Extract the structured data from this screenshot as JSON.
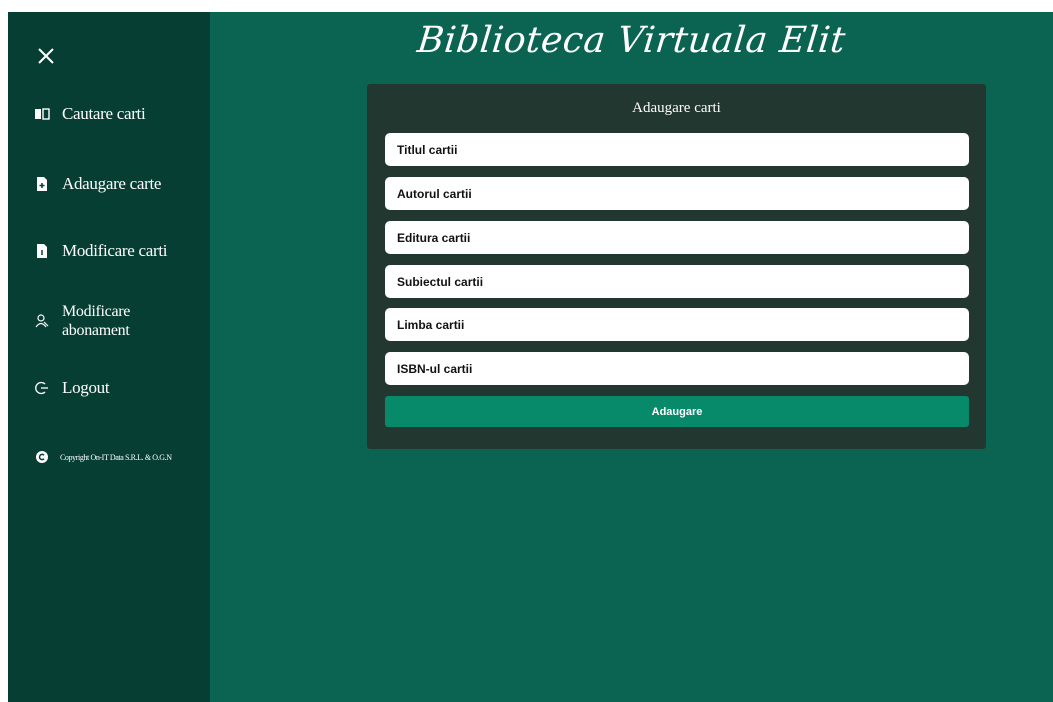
{
  "app": {
    "title": "Biblioteca Virtuala Elit"
  },
  "sidebar": {
    "close_icon": "close-icon",
    "items": [
      {
        "label": "Cautare carti",
        "icon": "book-open-icon"
      },
      {
        "label": "Adaugare carte",
        "icon": "file-plus-icon"
      },
      {
        "label": "Modificare carti",
        "icon": "file-edit-icon"
      },
      {
        "label_line1": "Modificare",
        "label_line2": "abonament",
        "icon": "user-subscription-icon"
      },
      {
        "label": "Logout",
        "icon": "logout-icon"
      }
    ],
    "copyright": "Copyright On-IT Data S.R.L. & O.G.N",
    "copyright_icon": "copyright-icon"
  },
  "form": {
    "title": "Adaugare carti",
    "fields": [
      {
        "placeholder": "Titlul cartii",
        "value": ""
      },
      {
        "placeholder": "Autorul cartii",
        "value": ""
      },
      {
        "placeholder": "Editura cartii",
        "value": ""
      },
      {
        "placeholder": "Subiectul cartii",
        "value": ""
      },
      {
        "placeholder": "Limba cartii",
        "value": ""
      },
      {
        "placeholder": "ISBN-ul cartii",
        "value": ""
      }
    ],
    "submit_label": "Adaugare"
  },
  "colors": {
    "main_bg": "#0b6452",
    "sidebar_bg": "#063e33",
    "card_bg": "#22372f",
    "button_bg": "#068a6a",
    "text": "#ffffff"
  }
}
